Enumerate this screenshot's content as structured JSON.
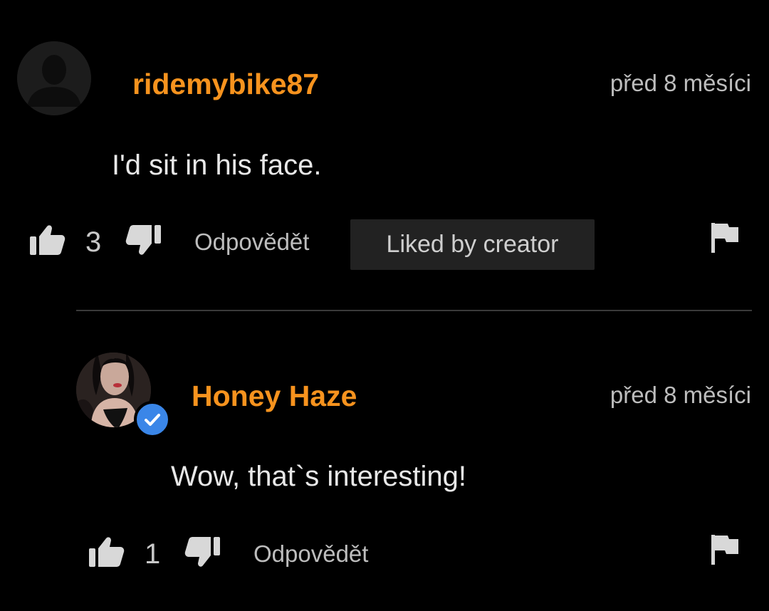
{
  "comments": [
    {
      "username": "ridemybike87",
      "timestamp": "před 8 měsíci",
      "text": "I'd sit in his face.",
      "likes": "3",
      "reply_label": "Odpovědět",
      "badge": "Liked by creator",
      "avatar": "default-user-avatar",
      "verified": false
    },
    {
      "username": "Honey Haze",
      "timestamp": "před 8 měsíci",
      "text": "Wow, that`s interesting!",
      "likes": "1",
      "reply_label": "Odpovědět",
      "avatar": "user-photo-avatar",
      "verified": true
    }
  ],
  "icons": {
    "like": "thumbs-up-icon",
    "dislike": "thumbs-down-icon",
    "report": "flag-icon",
    "verified": "checkmark-badge-icon"
  },
  "colors": {
    "background": "#000000",
    "username": "#f7931e",
    "verified": "#3a86e8",
    "badge_bg": "#222222"
  }
}
